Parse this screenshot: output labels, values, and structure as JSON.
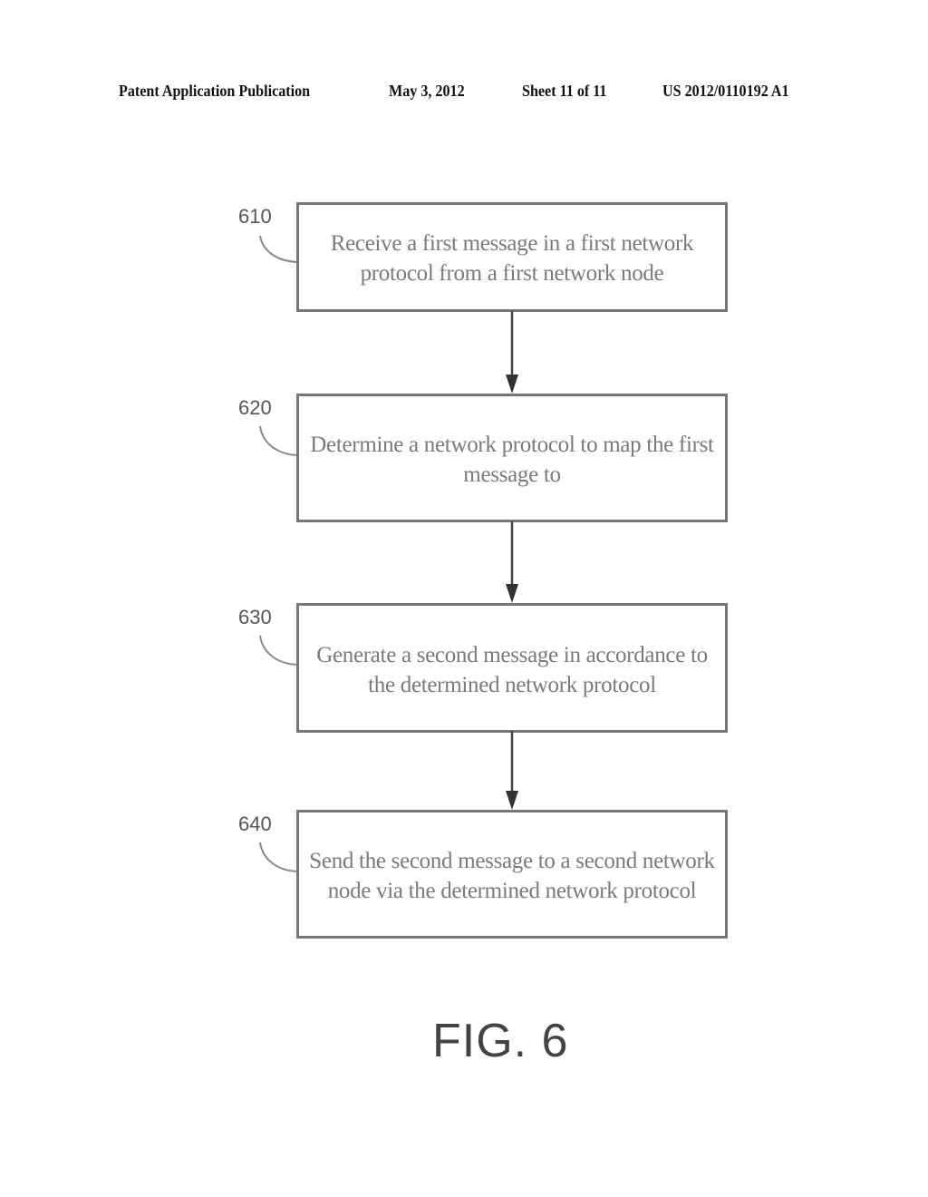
{
  "header": {
    "publication": "Patent Application Publication",
    "date": "May 3, 2012",
    "sheet": "Sheet 11 of 11",
    "number": "US 2012/0110192 A1"
  },
  "flowchart": {
    "steps": [
      {
        "ref": "610",
        "text_line1": "Receive a first message in a first network",
        "text_line2": "protocol from a first network node"
      },
      {
        "ref": "620",
        "text_line1": "Determine a network protocol to map the first",
        "text_line2": "message to"
      },
      {
        "ref": "630",
        "text_line1": "Generate a second message in accordance to",
        "text_line2": "the determined network protocol"
      },
      {
        "ref": "640",
        "text_line1": "Send the second message to a second network",
        "text_line2": "node via the determined network protocol"
      }
    ]
  },
  "figure_label": "FIG. 6"
}
